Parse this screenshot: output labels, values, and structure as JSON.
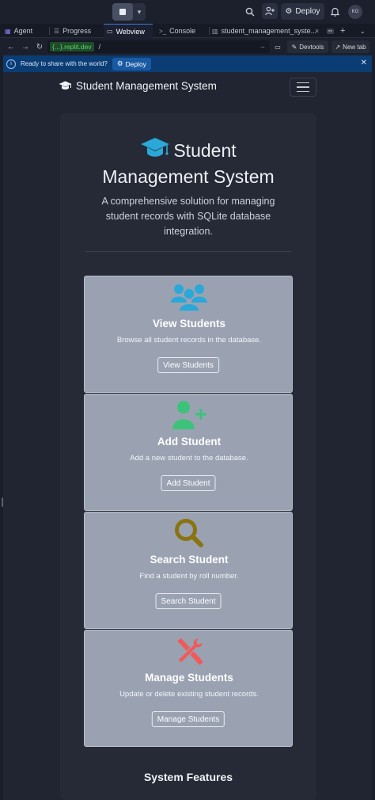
{
  "topbar": {
    "deploy_label": "Deploy",
    "avatar_initials": "KG",
    "icons": [
      "stop-icon",
      "chevron-down-icon",
      "search-icon",
      "add-user-icon",
      "deploy-icon",
      "bell-icon"
    ]
  },
  "tabs": [
    {
      "label": "Agent",
      "icon": "agent-icon"
    },
    {
      "label": "Progress",
      "icon": "progress-icon"
    },
    {
      "label": "Webview",
      "icon": "monitor-icon",
      "active": true
    },
    {
      "label": "Console",
      "icon": "terminal-icon"
    },
    {
      "label": "student_management_syste...",
      "icon": "database-icon"
    }
  ],
  "urlbar": {
    "host": "{...}.replit.dev",
    "path": "/",
    "devtools_label": "Devtools",
    "newtab_label": "New tab"
  },
  "banner": {
    "message": "Ready to share with the world?",
    "deploy_label": "Deploy"
  },
  "app": {
    "brand": "Student Management System",
    "hero_title_line1": "Student",
    "hero_title_line2": "Management System",
    "hero_subtitle": "A comprehensive solution for managing student records with SQLite database integration.",
    "features": [
      {
        "title": "View Students",
        "description": "Browse all student records in the database.",
        "button": "View Students",
        "icon": "users-icon",
        "color": "#2aa8d8"
      },
      {
        "title": "Add Student",
        "description": "Add a new student to the database.",
        "button": "Add Student",
        "icon": "user-plus-icon",
        "color": "#3cc27a"
      },
      {
        "title": "Search Student",
        "description": "Find a student by roll number.",
        "button": "Search Student",
        "icon": "search-icon",
        "color": "#8a7410"
      },
      {
        "title": "Manage Students",
        "description": "Update or delete existing student records.",
        "button": "Manage Students",
        "icon": "tools-icon",
        "color": "#f15a5a"
      }
    ],
    "system_features_title": "System Features"
  }
}
